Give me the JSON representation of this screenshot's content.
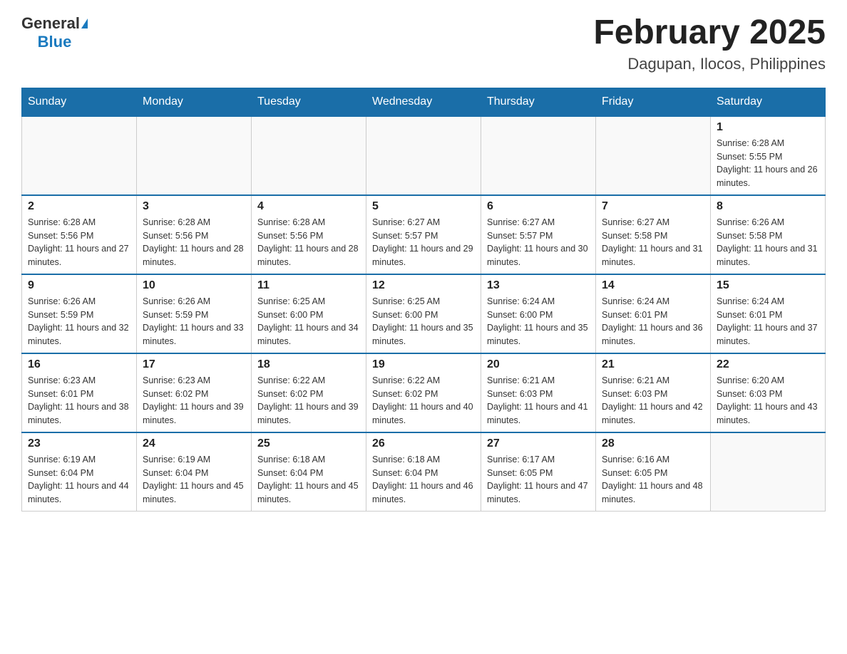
{
  "logo": {
    "general": "General",
    "blue": "Blue"
  },
  "title": {
    "month_year": "February 2025",
    "location": "Dagupan, Ilocos, Philippines"
  },
  "weekdays": [
    "Sunday",
    "Monday",
    "Tuesday",
    "Wednesday",
    "Thursday",
    "Friday",
    "Saturday"
  ],
  "weeks": [
    [
      {
        "day": "",
        "info": ""
      },
      {
        "day": "",
        "info": ""
      },
      {
        "day": "",
        "info": ""
      },
      {
        "day": "",
        "info": ""
      },
      {
        "day": "",
        "info": ""
      },
      {
        "day": "",
        "info": ""
      },
      {
        "day": "1",
        "info": "Sunrise: 6:28 AM\nSunset: 5:55 PM\nDaylight: 11 hours and 26 minutes."
      }
    ],
    [
      {
        "day": "2",
        "info": "Sunrise: 6:28 AM\nSunset: 5:56 PM\nDaylight: 11 hours and 27 minutes."
      },
      {
        "day": "3",
        "info": "Sunrise: 6:28 AM\nSunset: 5:56 PM\nDaylight: 11 hours and 28 minutes."
      },
      {
        "day": "4",
        "info": "Sunrise: 6:28 AM\nSunset: 5:56 PM\nDaylight: 11 hours and 28 minutes."
      },
      {
        "day": "5",
        "info": "Sunrise: 6:27 AM\nSunset: 5:57 PM\nDaylight: 11 hours and 29 minutes."
      },
      {
        "day": "6",
        "info": "Sunrise: 6:27 AM\nSunset: 5:57 PM\nDaylight: 11 hours and 30 minutes."
      },
      {
        "day": "7",
        "info": "Sunrise: 6:27 AM\nSunset: 5:58 PM\nDaylight: 11 hours and 31 minutes."
      },
      {
        "day": "8",
        "info": "Sunrise: 6:26 AM\nSunset: 5:58 PM\nDaylight: 11 hours and 31 minutes."
      }
    ],
    [
      {
        "day": "9",
        "info": "Sunrise: 6:26 AM\nSunset: 5:59 PM\nDaylight: 11 hours and 32 minutes."
      },
      {
        "day": "10",
        "info": "Sunrise: 6:26 AM\nSunset: 5:59 PM\nDaylight: 11 hours and 33 minutes."
      },
      {
        "day": "11",
        "info": "Sunrise: 6:25 AM\nSunset: 6:00 PM\nDaylight: 11 hours and 34 minutes."
      },
      {
        "day": "12",
        "info": "Sunrise: 6:25 AM\nSunset: 6:00 PM\nDaylight: 11 hours and 35 minutes."
      },
      {
        "day": "13",
        "info": "Sunrise: 6:24 AM\nSunset: 6:00 PM\nDaylight: 11 hours and 35 minutes."
      },
      {
        "day": "14",
        "info": "Sunrise: 6:24 AM\nSunset: 6:01 PM\nDaylight: 11 hours and 36 minutes."
      },
      {
        "day": "15",
        "info": "Sunrise: 6:24 AM\nSunset: 6:01 PM\nDaylight: 11 hours and 37 minutes."
      }
    ],
    [
      {
        "day": "16",
        "info": "Sunrise: 6:23 AM\nSunset: 6:01 PM\nDaylight: 11 hours and 38 minutes."
      },
      {
        "day": "17",
        "info": "Sunrise: 6:23 AM\nSunset: 6:02 PM\nDaylight: 11 hours and 39 minutes."
      },
      {
        "day": "18",
        "info": "Sunrise: 6:22 AM\nSunset: 6:02 PM\nDaylight: 11 hours and 39 minutes."
      },
      {
        "day": "19",
        "info": "Sunrise: 6:22 AM\nSunset: 6:02 PM\nDaylight: 11 hours and 40 minutes."
      },
      {
        "day": "20",
        "info": "Sunrise: 6:21 AM\nSunset: 6:03 PM\nDaylight: 11 hours and 41 minutes."
      },
      {
        "day": "21",
        "info": "Sunrise: 6:21 AM\nSunset: 6:03 PM\nDaylight: 11 hours and 42 minutes."
      },
      {
        "day": "22",
        "info": "Sunrise: 6:20 AM\nSunset: 6:03 PM\nDaylight: 11 hours and 43 minutes."
      }
    ],
    [
      {
        "day": "23",
        "info": "Sunrise: 6:19 AM\nSunset: 6:04 PM\nDaylight: 11 hours and 44 minutes."
      },
      {
        "day": "24",
        "info": "Sunrise: 6:19 AM\nSunset: 6:04 PM\nDaylight: 11 hours and 45 minutes."
      },
      {
        "day": "25",
        "info": "Sunrise: 6:18 AM\nSunset: 6:04 PM\nDaylight: 11 hours and 45 minutes."
      },
      {
        "day": "26",
        "info": "Sunrise: 6:18 AM\nSunset: 6:04 PM\nDaylight: 11 hours and 46 minutes."
      },
      {
        "day": "27",
        "info": "Sunrise: 6:17 AM\nSunset: 6:05 PM\nDaylight: 11 hours and 47 minutes."
      },
      {
        "day": "28",
        "info": "Sunrise: 6:16 AM\nSunset: 6:05 PM\nDaylight: 11 hours and 48 minutes."
      },
      {
        "day": "",
        "info": ""
      }
    ]
  ]
}
